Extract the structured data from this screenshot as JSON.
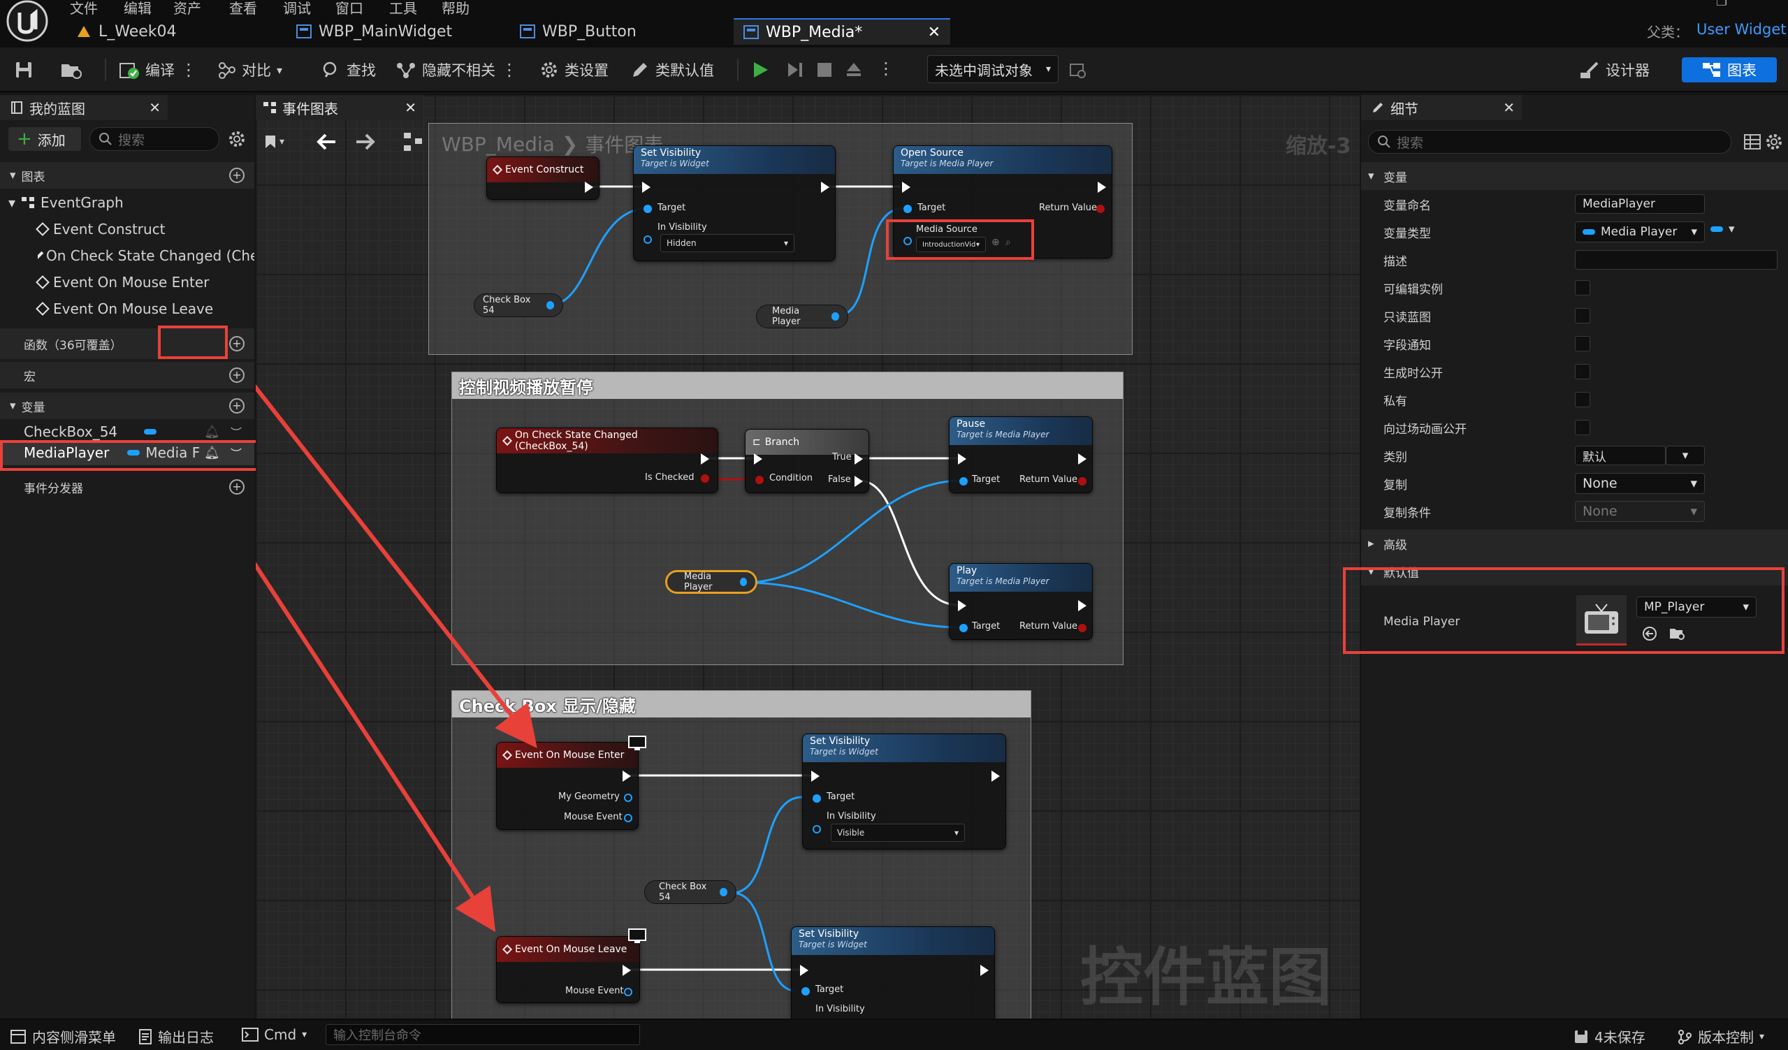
{
  "titlebar": {
    "menu": [
      "文件",
      "编辑",
      "资产",
      "查看",
      "调试",
      "窗口",
      "工具",
      "帮助"
    ],
    "tabs": [
      {
        "label": "L_Week04"
      },
      {
        "label": "WBP_MainWidget"
      },
      {
        "label": "WBP_Button"
      },
      {
        "label": "WBP_Media*"
      }
    ],
    "parent_class_label": "父类：",
    "parent_class_value": "User Widget"
  },
  "toolbar": {
    "compile": "编译",
    "diff": "对比",
    "find": "查找",
    "hide_unrelated": "隐藏不相关",
    "class_settings": "类设置",
    "class_defaults": "类默认值",
    "debug_select": "未选中调试对象",
    "designer": "设计器",
    "graph": "图表"
  },
  "left_panel": {
    "title": "我的蓝图",
    "add": "添加",
    "search_placeholder": "搜索",
    "graphs_section": "图表",
    "event_graph": "EventGraph",
    "events": [
      "Event Construct",
      "On Check State Changed (Checl",
      "Event On Mouse Enter",
      "Event On Mouse Leave"
    ],
    "functions_section": "函数（36可覆盖）",
    "macros_section": "宏",
    "variables_section": "变量",
    "variables": [
      {
        "name": "CheckBox_54",
        "type": ""
      },
      {
        "name": "MediaPlayer",
        "type": "Media F"
      }
    ],
    "dispatchers_section": "事件分发器"
  },
  "graph": {
    "tab_title": "事件图表",
    "breadcrumb_root": "WBP_Media",
    "breadcrumb_current": "事件图表",
    "zoom": "缩放-3",
    "watermark": "控件蓝图",
    "comment_play": "控制视频播放暂停",
    "comment_checkbox": "Check Box 显示/隐藏",
    "nodes": {
      "event_construct": "Event Construct",
      "set_visibility": "Set Visibility",
      "target_is_widget": "Target is Widget",
      "open_source": "Open Source",
      "target_is_media_player": "Target is Media Player",
      "target": "Target",
      "in_visibility": "In Visibility",
      "hidden": "Hidden",
      "visible": "Visible",
      "return_value": "Return Value",
      "media_source": "Media Source",
      "media_source_value": "IntroductionVid",
      "check_box_54": "Check Box 54",
      "media_player": "Media Player",
      "on_check_state_changed": "On Check State Changed (CheckBox_54)",
      "is_checked": "Is Checked",
      "branch": "Branch",
      "condition": "Condition",
      "true": "True",
      "false": "False",
      "pause": "Pause",
      "play": "Play",
      "event_on_mouse_enter": "Event On Mouse Enter",
      "event_on_mouse_leave": "Event On Mouse Leave",
      "my_geometry": "My Geometry",
      "mouse_event": "Mouse Event"
    }
  },
  "details": {
    "title": "细节",
    "search_placeholder": "搜索",
    "variable_section": "变量",
    "rows": {
      "var_name_label": "变量命名",
      "var_name_value": "MediaPlayer",
      "var_type_label": "变量类型",
      "var_type_value": "Media Player",
      "description_label": "描述",
      "editable_label": "可编辑实例",
      "readonly_label": "只读蓝图",
      "field_notify_label": "字段通知",
      "expose_spawn_label": "生成时公开",
      "private_label": "私有",
      "expose_cinematics_label": "向过场动画公开",
      "category_label": "类别",
      "category_value": "默认",
      "replication_label": "复制",
      "replication_value": "None",
      "rep_condition_label": "复制条件",
      "rep_condition_value": "None"
    },
    "advanced_section": "高级",
    "defaults_section": "默认值",
    "media_player_label": "Media Player",
    "media_player_asset": "MP_Player"
  },
  "statusbar": {
    "content_drawer": "内容侧滑菜单",
    "output_log": "输出日志",
    "cmd": "Cmd",
    "console_placeholder": "输入控制台命令",
    "unsaved": "4未保存",
    "source_control": "版本控制"
  },
  "colors": {
    "accent": "#0e6fde",
    "highlight": "#e8413a",
    "object_pin": "#1ea0ff",
    "bool_pin": "#b01010"
  }
}
